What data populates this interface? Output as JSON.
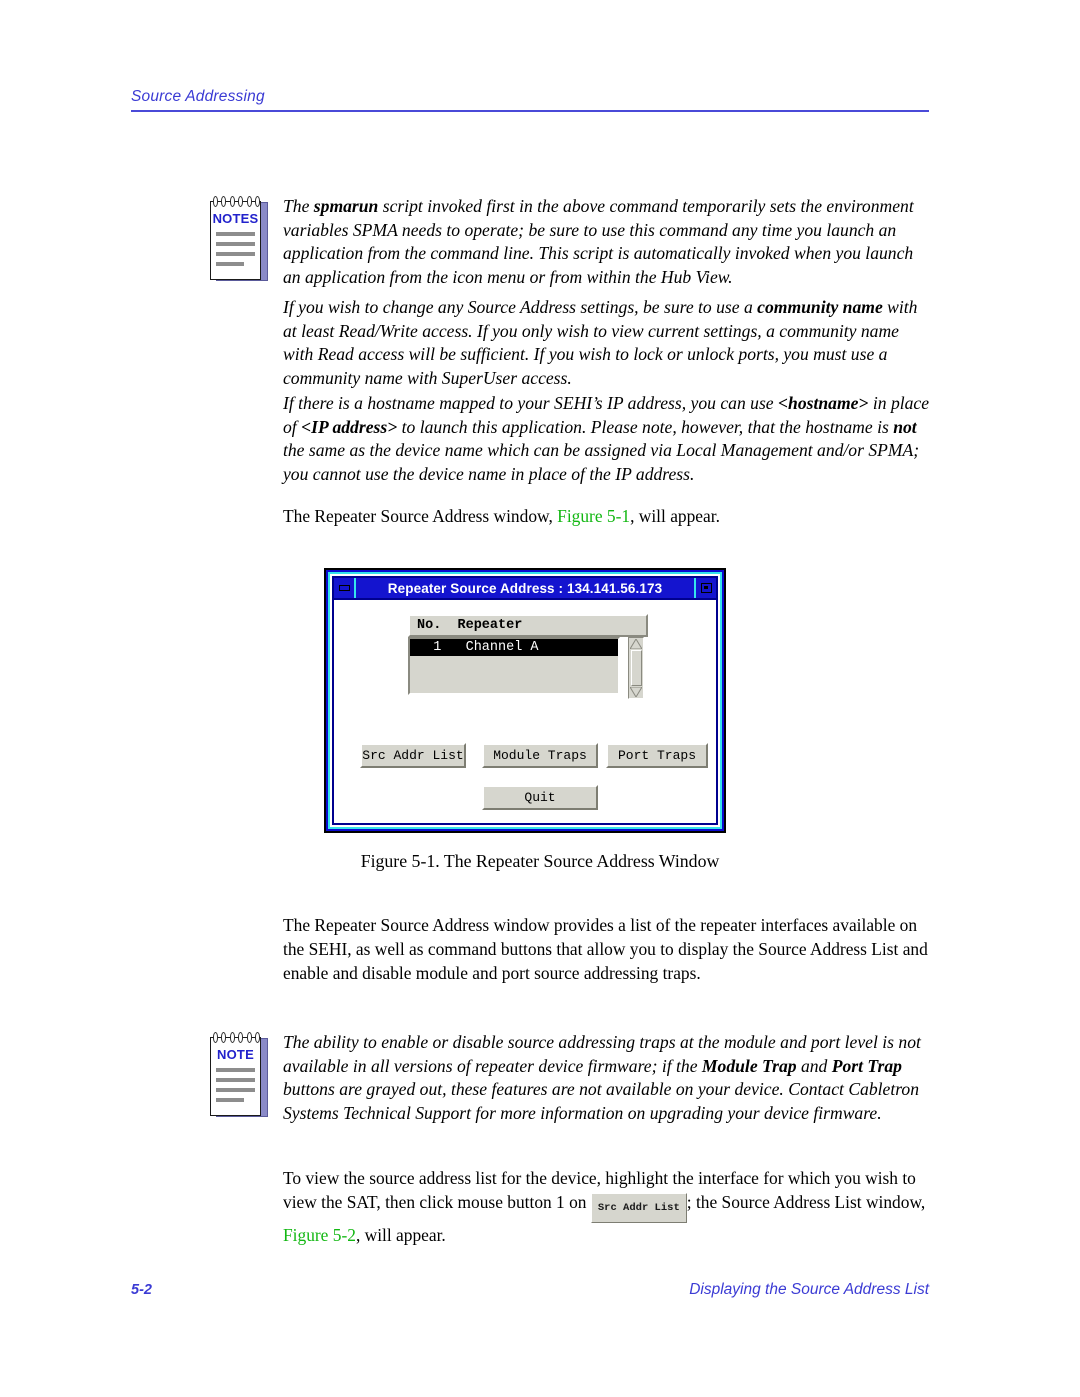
{
  "header": {
    "running_head": "Source Addressing"
  },
  "notes": [
    {
      "icon_label": "NOTES",
      "icon_name": "notepad-icon",
      "segments": [
        {
          "t": "The "
        },
        {
          "t": "spmarun",
          "b": true
        },
        {
          "t": " script invoked first in the above command temporarily sets the environment variables SPMA needs to operate; be sure to use this command any time you launch an application from the command line. This script is automatically invoked when you launch an application from the icon menu or from within the Hub View."
        }
      ]
    },
    {
      "segments": [
        {
          "t": "If you wish to change any Source Address settings, be sure to use a "
        },
        {
          "t": "community name",
          "b": true
        },
        {
          "t": " with at least Read/Write access. If you only wish to view current settings, a community name with Read access will be sufficient. If you wish to lock or unlock ports, you must use a community name with SuperUser access."
        }
      ]
    },
    {
      "segments": [
        {
          "t": "If there is a hostname mapped to your SEHI’s IP address, you can use "
        },
        {
          "t": "<hostname>",
          "b": true
        },
        {
          "t": " in place of "
        },
        {
          "t": "<IP address>",
          "b": true
        },
        {
          "t": " to launch this application. Please note, however, that the hostname is "
        },
        {
          "t": "not",
          "b": true
        },
        {
          "t": " the same as the device name which can be assigned via Local Management and/or SPMA; you cannot use the device name in place of the IP address."
        }
      ]
    }
  ],
  "intro_line": {
    "pre": "The Repeater Source Address window, ",
    "link": "Figure 5-1",
    "post": ", will appear."
  },
  "dialog": {
    "title": "Repeater Source Address : 134.141.56.173",
    "minimize_icon": "minimize-icon",
    "maximize_icon": "maximize-icon",
    "list": {
      "header": "No.  Repeater",
      "rows": [
        {
          "no": "1",
          "name": "Channel A",
          "selected": true
        }
      ],
      "row_text": "  1   Channel A"
    },
    "buttons": {
      "src_addr_list": "Src Addr List",
      "module_traps": "Module Traps",
      "port_traps": "Port Traps",
      "quit": "Quit"
    }
  },
  "figure_caption": "Figure 5-1.  The Repeater Source Address Window",
  "body_paragraph": "The Repeater Source Address window provides a list of the repeater interfaces available on the SEHI, as well as command buttons that allow you to display the Source Address List and enable and disable module and port source addressing traps.",
  "note2": {
    "icon_label": "NOTE",
    "segments": [
      {
        "t": "The ability to enable or disable source addressing traps at the module and port level is not available in all versions of repeater device firmware; if the "
      },
      {
        "t": "Module Trap",
        "b": true
      },
      {
        "t": " and "
      },
      {
        "t": "Port Trap",
        "b": true
      },
      {
        "t": " buttons are grayed out, these features are not available on your device. Contact Cabletron Systems Technical Support for more information on upgrading your device firmware."
      }
    ]
  },
  "closing_paragraph": {
    "part1": "To view the source address list for the device, highlight the interface for which you wish to view the SAT, then click mouse button 1 on ",
    "inline_button": "Src Addr List",
    "part2": "; the Source Address List window, ",
    "link": "Figure 5-2",
    "part3": ", will appear."
  },
  "footer": {
    "page_number": "5-2",
    "section_title": "Displaying the Source Address List"
  },
  "colors": {
    "accent_blue": "#3b3bd4",
    "link_green": "#12b712",
    "title_bar": "#1414cf",
    "widget_face": "#d6d6ce"
  }
}
